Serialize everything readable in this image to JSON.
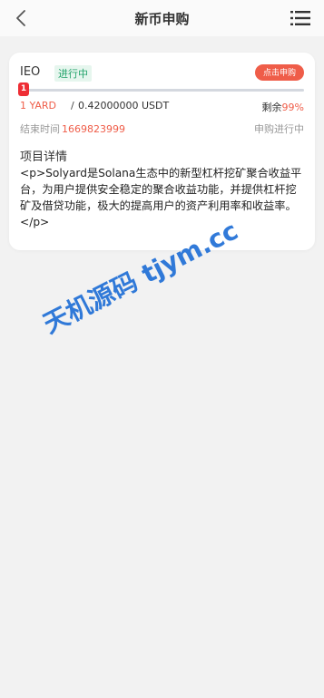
{
  "header": {
    "title": "新币申购",
    "back_icon": "chevron-left-icon",
    "menu_icon": "list-menu-icon"
  },
  "card": {
    "coin_name": "IEO",
    "status": "进行中",
    "subscribe_label": "点击申购",
    "progress": {
      "knob_label": "1",
      "percent_filled": 1
    },
    "sold": "1 YARD",
    "separator": "/",
    "total": "0.42000000 USDT",
    "remain_label": "剩余",
    "remain_pct": "99%",
    "end_time_label": "结束时间",
    "end_time_value": "1669823999",
    "phase": "申购进行中",
    "detail_title": "项目详情",
    "detail_text": "<p>Solyard是Solana生态中的新型杠杆挖矿聚合收益平台，为用户提供安全稳定的聚合收益功能，并提供杠杆挖矿及借贷功能，极大的提高用户的资产利用率和收益率。</p>"
  },
  "watermark": {
    "text": "天机源码 tjym.cc"
  },
  "colors": {
    "accent": "#ef5d49",
    "status_green": "#23a36b",
    "background": "#f2f2f2",
    "watermark": "#1f6fd6"
  }
}
